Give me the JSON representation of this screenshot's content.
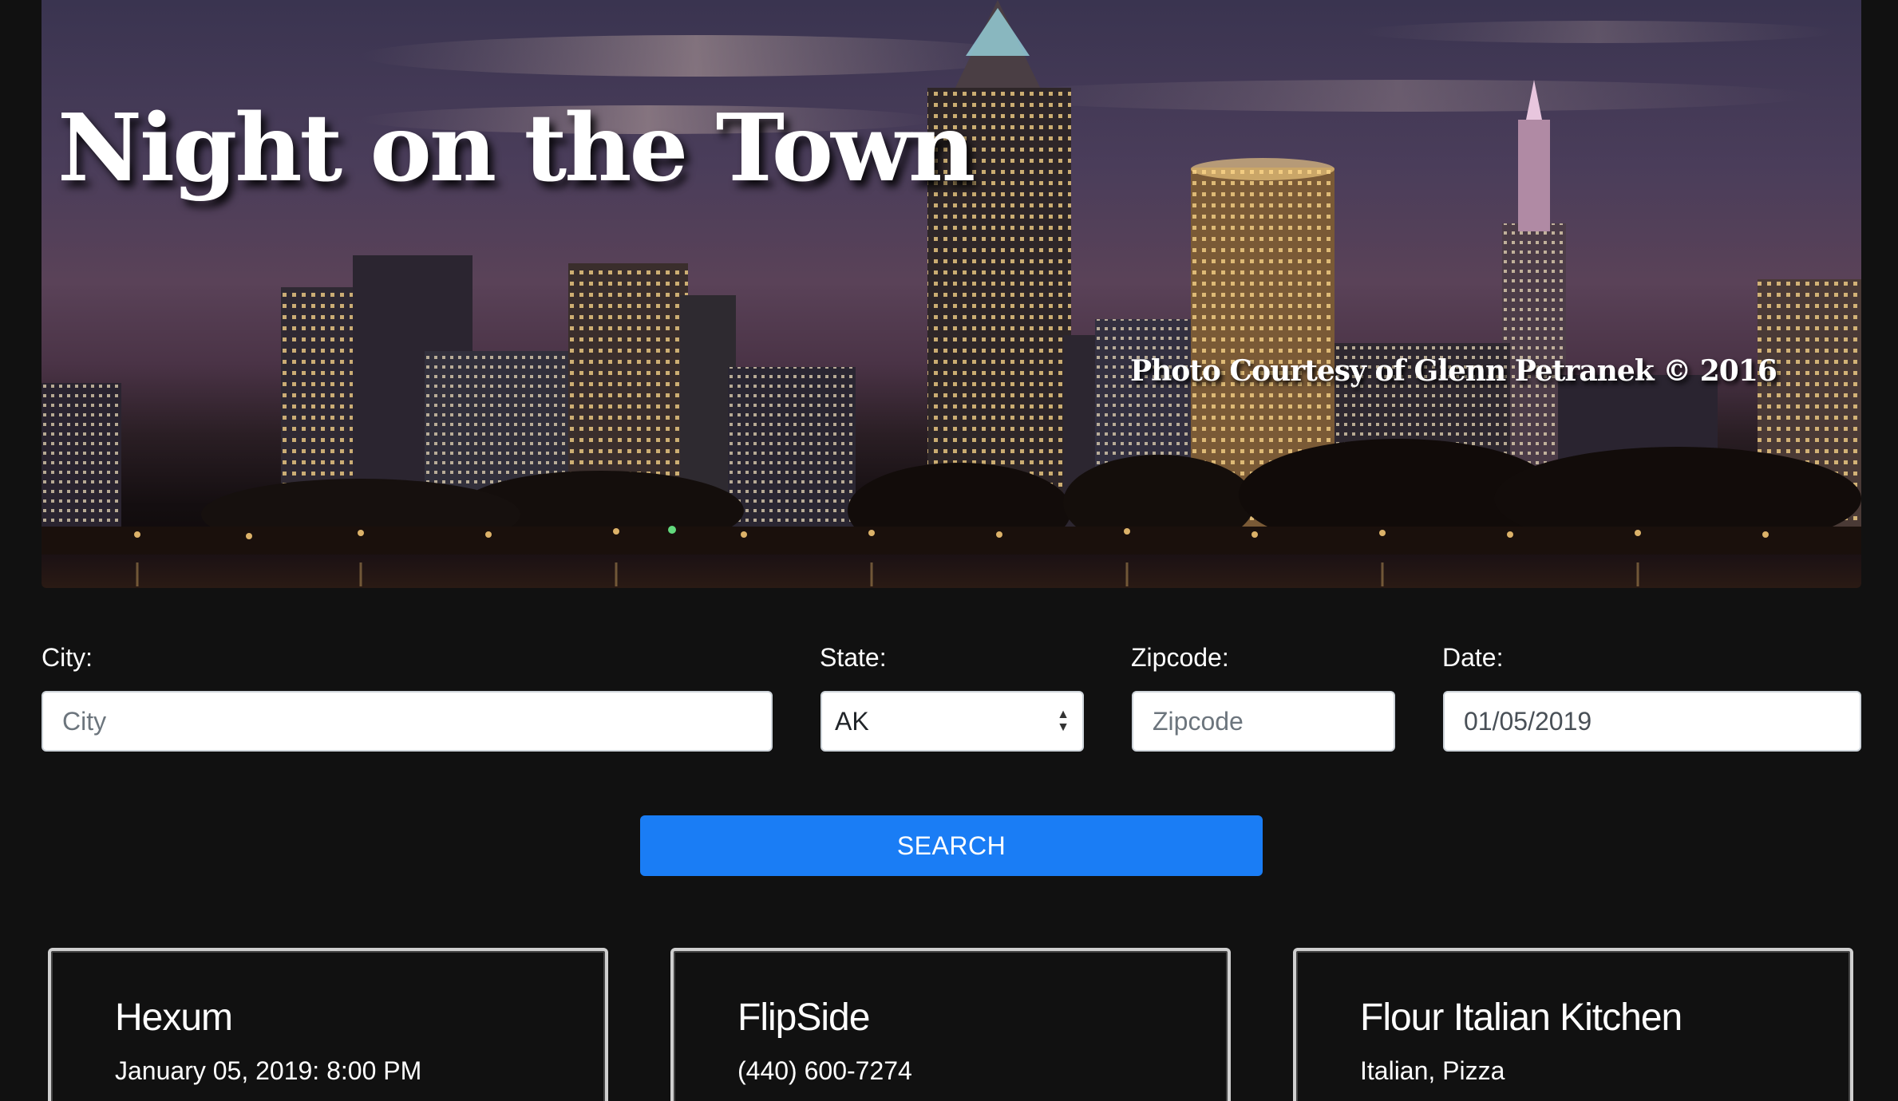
{
  "hero": {
    "title": "Night on the Town",
    "photo_credit": "Photo Courtesy of Glenn Petranek © 2016"
  },
  "search_form": {
    "city": {
      "label": "City:",
      "placeholder": "City",
      "value": ""
    },
    "state": {
      "label": "State:",
      "selected": "AK"
    },
    "zipcode": {
      "label": "Zipcode:",
      "placeholder": "Zipcode",
      "value": ""
    },
    "date": {
      "label": "Date:",
      "value": "01/05/2019"
    },
    "search_label": "SEARCH"
  },
  "results": [
    {
      "name": "Hexum",
      "detail": "January 05, 2019: 8:00 PM"
    },
    {
      "name": "FlipSide",
      "detail": "(440) 600-7274"
    },
    {
      "name": "Flour Italian Kitchen",
      "detail": "Italian, Pizza"
    }
  ],
  "colors": {
    "page_background": "#111111",
    "accent_button": "#1a7df5",
    "card_border": "#cfcfcf"
  }
}
